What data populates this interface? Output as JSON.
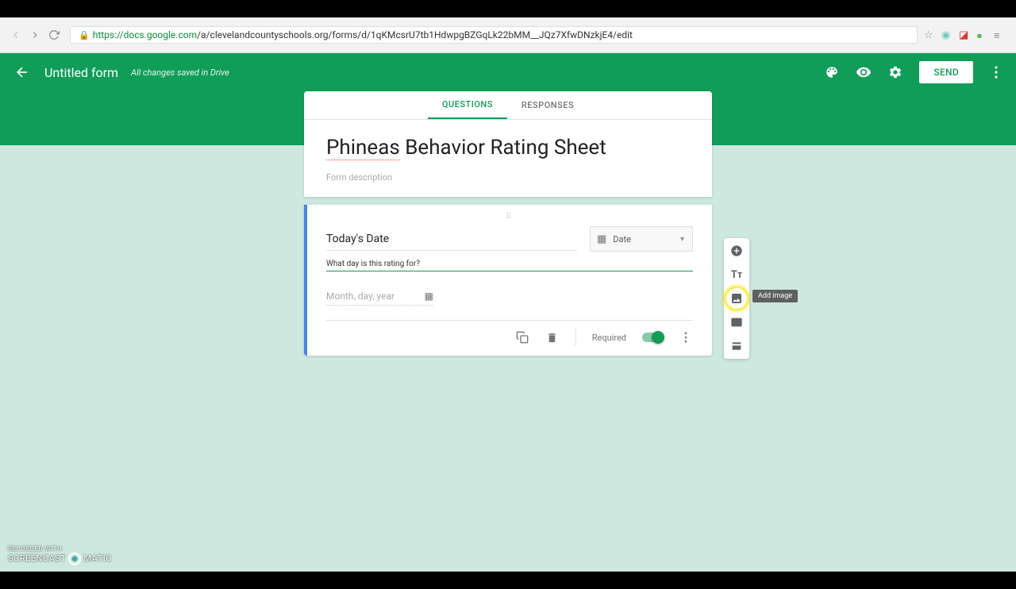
{
  "browser": {
    "url_host": "https://docs.google.com",
    "url_path": "/a/clevelandcountyschools.org/forms/d/1qKMcsrU7tb1HdwpgBZGqLk22bMM__JQz7XfwDNzkjE4/edit"
  },
  "header": {
    "title": "Untitled form",
    "save_status": "All changes saved in Drive",
    "send_label": "SEND"
  },
  "tabs": {
    "questions": "QUESTIONS",
    "responses": "RESPONSES"
  },
  "form": {
    "title_underlined": "Phineas",
    "title_rest": " Behavior Rating Sheet",
    "description_placeholder": "Form description"
  },
  "question": {
    "title": "Today's Date",
    "type_label": "Date",
    "description_value": "What day is this rating for?",
    "date_placeholder": "Month, day, year",
    "required_label": "Required"
  },
  "tooltip": {
    "add_image": "Add image"
  },
  "watermark": {
    "line1": "RECORDED WITH",
    "line2": "SCREENCAST",
    "line3": "MATIC"
  }
}
